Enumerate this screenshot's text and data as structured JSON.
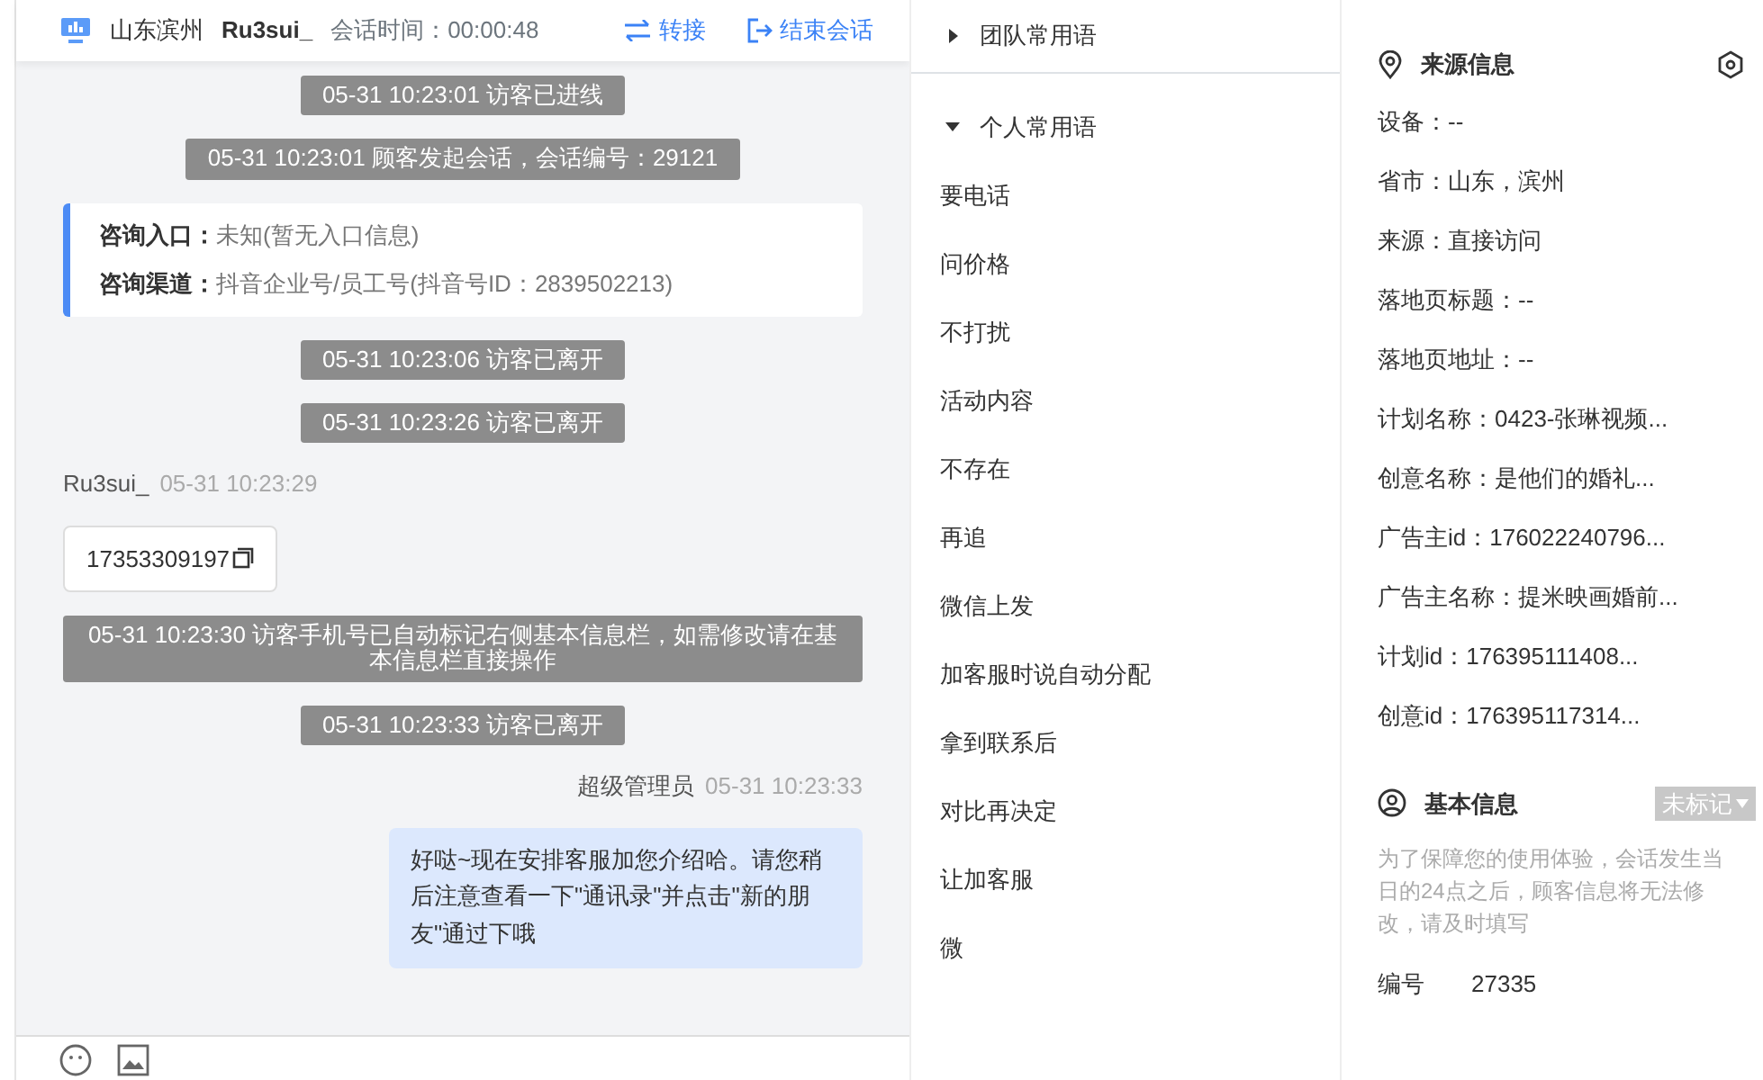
{
  "header": {
    "location": "山东滨州",
    "visitor": "Ru3sui_",
    "session_time": "会话时间：00:00:48",
    "transfer": "转接",
    "end_session": "结束会话"
  },
  "messages": [
    {
      "kind": "system",
      "text": "05-31 10:23:01 访客已进线"
    },
    {
      "kind": "system",
      "text": "05-31 10:23:01 顾客发起会话，会话编号：29121"
    },
    {
      "kind": "info",
      "lines": [
        {
          "label": "咨询入口：",
          "value": "未知(暂无入口信息)"
        },
        {
          "label": "咨询渠道：",
          "value": "抖音企业号/员工号(抖音号ID：2839502213)"
        }
      ]
    },
    {
      "kind": "system",
      "text": "05-31 10:23:06 访客已离开"
    },
    {
      "kind": "system",
      "text": "05-31 10:23:26 访客已离开"
    },
    {
      "kind": "visitor",
      "sender": "Ru3sui_",
      "time": "05-31 10:23:29",
      "text": "17353309197"
    },
    {
      "kind": "system",
      "text": "05-31 10:23:30 访客手机号已自动标记右侧基本信息栏，如需修改请在基本信息栏直接操作"
    },
    {
      "kind": "system",
      "text": "05-31 10:23:33 访客已离开"
    },
    {
      "kind": "agent",
      "sender": "超级管理员",
      "time": "05-31 10:23:33",
      "text": "好哒~现在安排客服加您介绍哈。请您稍后注意查看一下\"通讯录\"并点击\"新的朋友\"通过下哦"
    }
  ],
  "phrase_groups": [
    {
      "title": "团队常用语",
      "expanded": false
    },
    {
      "title": "个人常用语",
      "expanded": true
    }
  ],
  "phrases": [
    "要电话",
    "问价格",
    "不打扰",
    "活动内容",
    "不存在",
    "再追",
    "微信上发",
    "加客服时说自动分配",
    "拿到联系后",
    "对比再决定",
    "让加客服",
    "微"
  ],
  "source_info": {
    "title": "来源信息",
    "fields": [
      "设备：--",
      "省市：山东，滨州",
      "来源：直接访问",
      "落地页标题：--",
      "落地页地址：--",
      "计划名称：0423-张琳视频...",
      "创意名称：是他们的婚礼...",
      "广告主id：176022240796...",
      "广告主名称：提米映画婚前...",
      "计划id：176395111408...",
      "创意id：176395117314..."
    ]
  },
  "basic_info": {
    "title": "基本信息",
    "tag": "未标记",
    "notice": "为了保障您的使用体验，会话发生当日的24点之后，顾客信息将无法修改，请及时填写",
    "fields": [
      {
        "label": "编号",
        "value": "27335"
      }
    ]
  }
}
